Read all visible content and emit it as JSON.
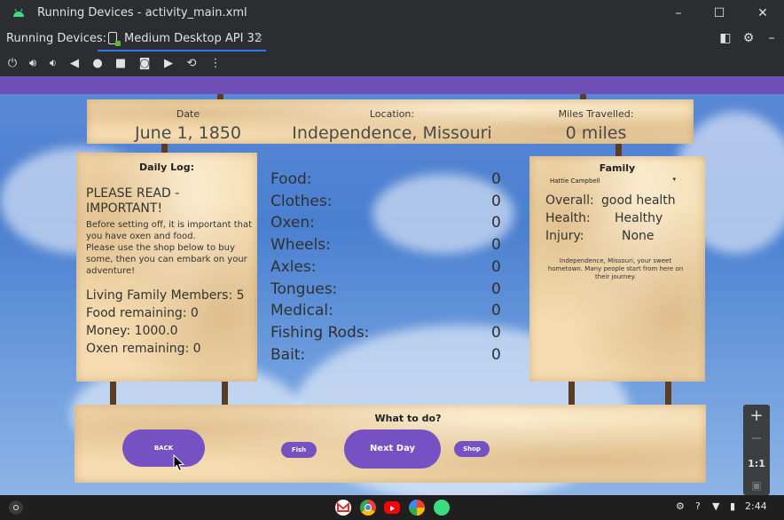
{
  "window": {
    "title": "Running Devices - activity_main.xml",
    "controls": [
      "minimize",
      "maximize",
      "close"
    ]
  },
  "tabbar": {
    "section_label": "Running Devices:",
    "tab_label": "Medium Desktop API 32",
    "tab_close": "×"
  },
  "toolbar": {
    "icons": [
      "power-icon",
      "volume-up-icon",
      "volume-down-icon",
      "back-icon",
      "home-icon",
      "overview-icon",
      "screenshot-icon",
      "screen-record-icon",
      "reset-icon",
      "more-icon"
    ]
  },
  "app": {
    "header": {
      "date_label": "Date",
      "date_value": "June 1, 1850",
      "location_label": "Location:",
      "location_value": "Independence, Missouri",
      "miles_label": "Miles Travelled:",
      "miles_value": "0 miles"
    },
    "daily_log": {
      "title": "Daily Log:",
      "heading": "PLEASE READ - IMPORTANT!",
      "message": "Before setting off, it is important that you have oxen and food.\n Please use the shop below to buy some, then you can embark on your adventure!",
      "stats": [
        "Living Family Members: 5",
        "Food remaining: 0",
        "Money: 1000.0",
        "Oxen remaining: 0"
      ]
    },
    "inventory": [
      {
        "name": "Food:",
        "value": "0"
      },
      {
        "name": "Clothes:",
        "value": "0"
      },
      {
        "name": "Oxen:",
        "value": "0"
      },
      {
        "name": "Wheels:",
        "value": "0"
      },
      {
        "name": "Axles:",
        "value": "0"
      },
      {
        "name": "Tongues:",
        "value": "0"
      },
      {
        "name": "Medical:",
        "value": "0"
      },
      {
        "name": "Fishing Rods:",
        "value": "0"
      },
      {
        "name": "Bait:",
        "value": "0"
      }
    ],
    "family": {
      "title": "Family",
      "selected_member": "Hattie Campbell",
      "overall_label": "Overall:",
      "overall_value": "good health",
      "health_label": "Health:",
      "health_value": "Healthy",
      "injury_label": "Injury:",
      "injury_value": "None",
      "description": "Independence, Missouri, your sweet hometown. Many people start from here on their journey."
    },
    "actions": {
      "title": "What to do?",
      "back": "BACK",
      "fish": "Fish",
      "next_day": "Next Day",
      "shop": "Shop"
    },
    "accent_color": "#7651c4",
    "appbar_color": "#6e4fb6"
  },
  "zoom": {
    "plus": "+",
    "minus": "−",
    "actual": "1:1"
  },
  "shelf": {
    "time": "2:44",
    "apps": [
      "gmail-icon",
      "chrome-icon",
      "youtube-icon",
      "photos-icon",
      "android-studio-icon"
    ]
  }
}
